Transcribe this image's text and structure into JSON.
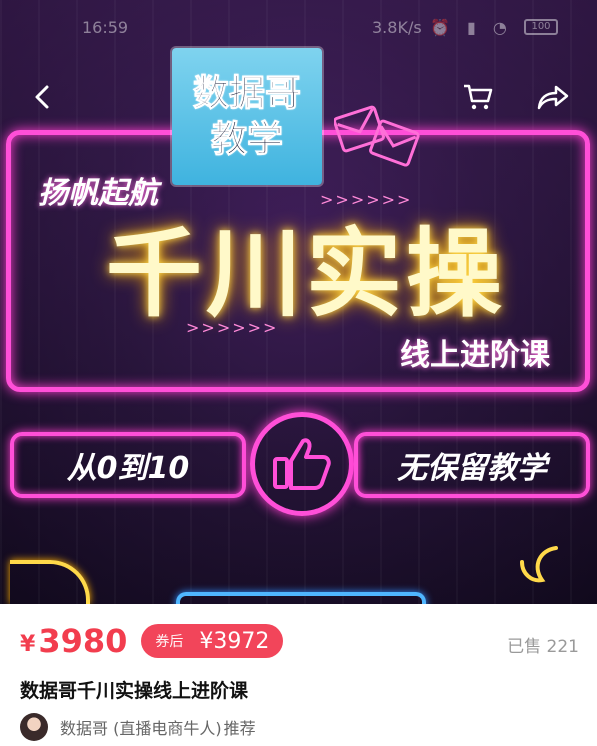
{
  "status_bar": {
    "time": "16:59",
    "network_speed": "3.8K/s",
    "battery": "100"
  },
  "nav": {
    "back_icon": "chevron-left-icon",
    "cart_icon": "cart-icon",
    "share_icon": "share-icon"
  },
  "banner": {
    "logo_line1": "数据哥",
    "logo_line2": "教学",
    "tagline": "扬帆起航",
    "main_title": "千川实操",
    "subtitle": "线上进阶课",
    "arrows": ">>>>>>",
    "left_pill": "从0到10",
    "right_pill": "无保留教学",
    "center_icon": "thumbs-up-icon"
  },
  "product": {
    "currency": "¥",
    "price": "3980",
    "coupon_label": "券后",
    "coupon_price": "¥3972",
    "sold": "已售 221",
    "title": "数据哥千川实操线上进阶课",
    "recommender": "数据哥 (直播电商牛人)",
    "recommend_suffix": "推荐"
  },
  "colors": {
    "price_red": "#f23d4e",
    "neon_pink": "#ff4fd8",
    "neon_yellow": "#ffd94a"
  }
}
